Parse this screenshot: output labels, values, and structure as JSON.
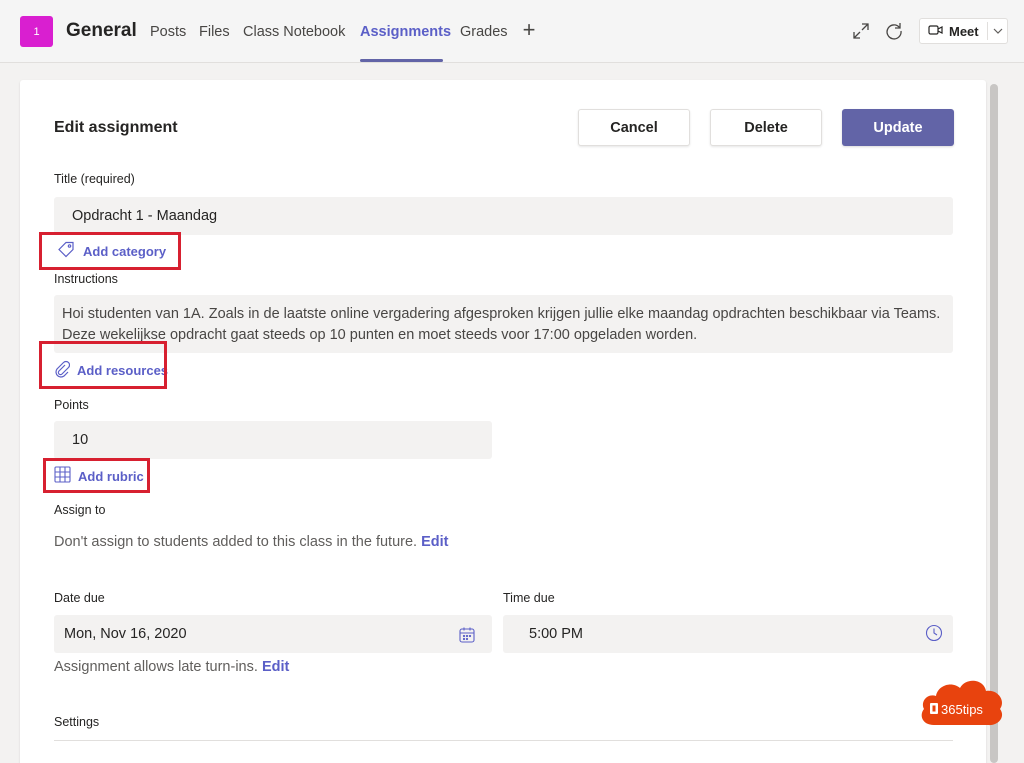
{
  "app": {
    "team_initial": "1",
    "channel": "General",
    "tabs": [
      {
        "label": "Posts"
      },
      {
        "label": "Files"
      },
      {
        "label": "Class Notebook"
      },
      {
        "label": "Assignments"
      },
      {
        "label": "Grades"
      }
    ],
    "active_tab": "Assignments",
    "meet_label": "Meet",
    "colors": {
      "brand": "#6264a7",
      "team_tile": "#d91fd0",
      "highlight": "#d72030"
    }
  },
  "form": {
    "heading": "Edit assignment",
    "cancel_label": "Cancel",
    "delete_label": "Delete",
    "update_label": "Update",
    "title_label": "Title (required)",
    "title_value": "Opdracht 1 - Maandag",
    "add_category_label": "Add category",
    "instructions_label": "Instructions",
    "instructions_value": "Hoi studenten van 1A. Zoals in de laatste online vergadering afgesproken krijgen jullie elke maandag opdrachten beschikbaar via Teams. Deze wekelijkse opdracht gaat steeds op 10 punten en moet steeds voor 17:00 opgeladen worden.",
    "add_resources_label": "Add resources",
    "points_label": "Points",
    "points_value": "10",
    "add_rubric_label": "Add rubric",
    "assign_to_label": "Assign to",
    "assign_to_text": "Don't assign to students added to this class in the future.",
    "assign_to_edit": "Edit",
    "date_due_label": "Date due",
    "date_due_value": "Mon, Nov 16, 2020",
    "time_due_label": "Time due",
    "time_due_value": "5:00 PM",
    "late_text": "Assignment allows late turn-ins.",
    "late_edit": "Edit",
    "settings_label": "Settings"
  },
  "watermark": {
    "text": "365tips"
  }
}
